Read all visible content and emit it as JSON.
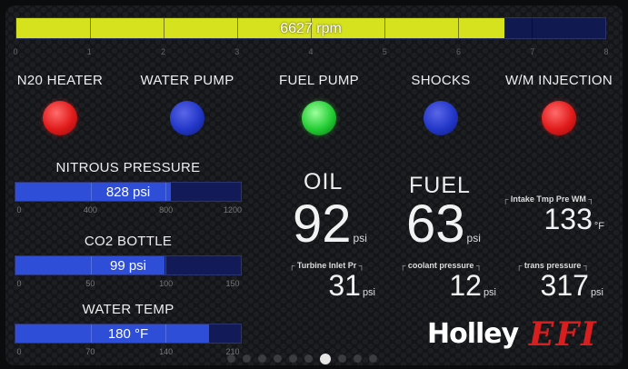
{
  "rpm": {
    "value": 6627,
    "max": 8,
    "fraction": 0.8284,
    "text": "6627 rpm",
    "ticks": [
      "0",
      "1",
      "2",
      "3",
      "4",
      "5",
      "6",
      "7",
      "8"
    ],
    "fill_color": "#d7e21f",
    "track_color": "#101a50"
  },
  "indicators": [
    {
      "label": "N20 HEATER",
      "state": "red"
    },
    {
      "label": "WATER PUMP",
      "state": "blue"
    },
    {
      "label": "FUEL PUMP",
      "state": "green"
    },
    {
      "label": "SHOCKS",
      "state": "blue"
    },
    {
      "label": "W/M INJECTION",
      "state": "red"
    }
  ],
  "gauges": [
    {
      "title": "NITROUS PRESSURE",
      "text": "828 psi",
      "value": 828,
      "min": 0,
      "max": 1200,
      "ticks": [
        "0",
        "400",
        "800",
        "1200"
      ]
    },
    {
      "title": "CO2 BOTTLE",
      "text": "99 psi",
      "value": 99,
      "min": 0,
      "max": 150,
      "ticks": [
        "0",
        "50",
        "100",
        "150"
      ]
    },
    {
      "title": "WATER TEMP",
      "text": "180 °F",
      "value": 180,
      "min": 0,
      "max": 210,
      "ticks": [
        "0",
        "70",
        "140",
        "210"
      ]
    }
  ],
  "big": {
    "oil": {
      "title": "OIL",
      "value": "92",
      "unit": "psi"
    },
    "fuel": {
      "title": "FUEL",
      "value": "63",
      "unit": "psi"
    }
  },
  "small": {
    "intake": {
      "title": "Intake Tmp Pre WM",
      "value": "133",
      "unit": "°F"
    },
    "turbine": {
      "title": "Turbine Inlet Pr",
      "value": "31",
      "unit": "psi"
    },
    "coolant": {
      "title": "coolant pressure",
      "value": "12",
      "unit": "psi"
    },
    "trans": {
      "title": "trans pressure",
      "value": "317",
      "unit": "psi"
    }
  },
  "logo": {
    "brand": "Holley",
    "product": "EFI"
  },
  "pager": {
    "count": 10,
    "active_index": 6
  },
  "colors": {
    "gauge_fill": "#2f4ed8",
    "lamp_red": "#e01a1a",
    "lamp_blue": "#2236c8",
    "lamp_green": "#22cc33"
  }
}
